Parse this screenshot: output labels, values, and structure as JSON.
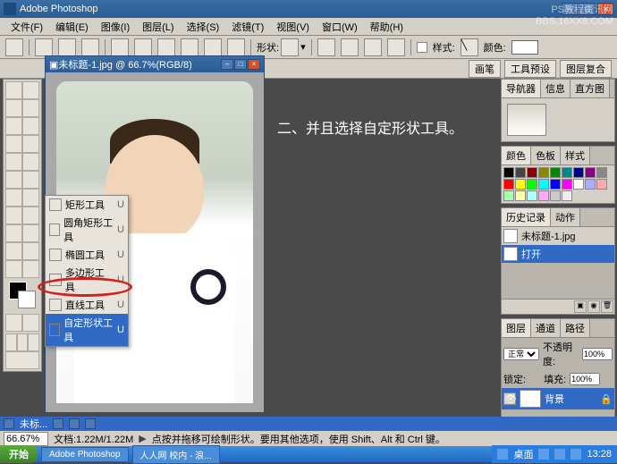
{
  "app": {
    "title": "Adobe Photoshop"
  },
  "menu": {
    "items": [
      "文件(F)",
      "编辑(E)",
      "图像(I)",
      "图层(L)",
      "选择(S)",
      "滤镜(T)",
      "视图(V)",
      "窗口(W)",
      "帮助(H)"
    ]
  },
  "optbar": {
    "shape_label": "形状:",
    "style_label": "样式:",
    "color_label": "颜色:"
  },
  "optbar2": {
    "brush": "画笔",
    "tool_preset": "工具预设",
    "layer_comp": "图层复合"
  },
  "document": {
    "title": "未标题-1.jpg @ 66.7%(RGB/8)"
  },
  "flyout": {
    "items": [
      {
        "label": "矩形工具",
        "key": "U"
      },
      {
        "label": "圆角矩形工具",
        "key": "U"
      },
      {
        "label": "椭圆工具",
        "key": "U"
      },
      {
        "label": "多边形工具",
        "key": "U"
      },
      {
        "label": "直线工具",
        "key": "U"
      },
      {
        "label": "自定形状工具",
        "key": "U"
      }
    ],
    "selected_index": 5
  },
  "annotation": "二、并且选择自定形状工具。",
  "watermark": {
    "line1": "PS教程资讯网",
    "line2": "BBS.16XX8.COM"
  },
  "panels": {
    "navigator": {
      "tabs": [
        "导航器",
        "信息",
        "直方图"
      ]
    },
    "color": {
      "tabs": [
        "颜色",
        "色板",
        "样式"
      ]
    },
    "history": {
      "tabs": [
        "历史记录",
        "动作"
      ],
      "doc_name": "未标题-1.jpg",
      "step": "打开"
    },
    "layers": {
      "tabs": [
        "图层",
        "通道",
        "路径"
      ],
      "mode": "正常",
      "opacity_label": "不透明度:",
      "opacity": "100%",
      "lock_label": "锁定:",
      "fill_label": "填充:",
      "fill": "100%",
      "layer_name": "背景"
    }
  },
  "status": {
    "row2_label": "未标...",
    "zoom": "66.67%",
    "doc_size": "文档:1.22M/1.22M",
    "hint": "点按并拖移可绘制形状。要用其他选项，使用 Shift、Alt 和 Ctrl 键。"
  },
  "taskbar": {
    "start": "开始",
    "items": [
      "Adobe Photoshop",
      "人人网 校内 - 浪..."
    ],
    "desktop": "桌面",
    "time": "13:28"
  },
  "swatch_colors": [
    "#000",
    "#444",
    "#800",
    "#880",
    "#080",
    "#088",
    "#008",
    "#808",
    "#888",
    "#f00",
    "#ff0",
    "#0f0",
    "#0ff",
    "#00f",
    "#f0f",
    "#fff",
    "#aaf",
    "#faa",
    "#afa",
    "#ffa",
    "#aff",
    "#faf",
    "#ccc",
    "#eee"
  ]
}
